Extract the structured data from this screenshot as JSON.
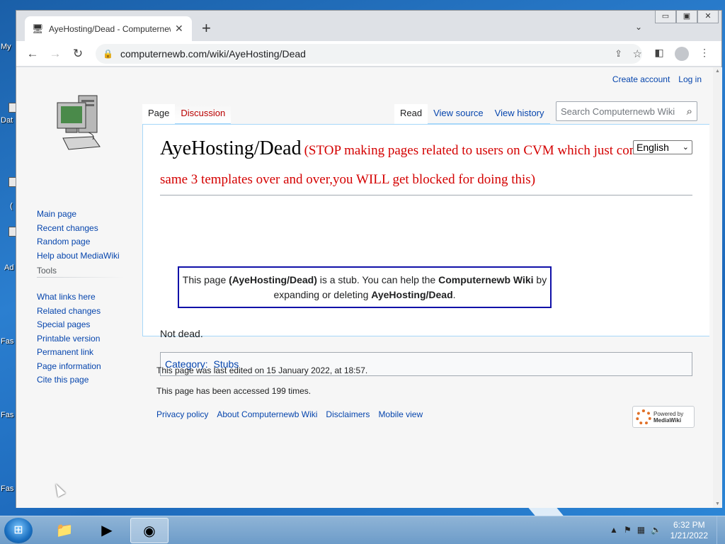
{
  "desktop": {
    "labels": [
      "My",
      "Dat",
      "(",
      "Ad",
      "Fas",
      "Fas",
      "Fas"
    ]
  },
  "browser": {
    "tab": {
      "title": "AyeHosting/Dead - Computernewb Wiki",
      "close": "✕"
    },
    "new_tab": "+",
    "url": "computernewb.com/wiki/AyeHosting/Dead",
    "window_buttons": [
      "▭",
      "▣",
      "✕"
    ]
  },
  "wiki": {
    "personal": {
      "create_account": "Create account",
      "log_in": "Log in"
    },
    "navigation": [
      "Main page",
      "Recent changes",
      "Random page",
      "Help about MediaWiki"
    ],
    "tools_title": "Tools",
    "tools": [
      "What links here",
      "Related changes",
      "Special pages",
      "Printable version",
      "Permanent link",
      "Page information",
      "Cite this page"
    ],
    "tabs_left": {
      "page": "Page",
      "discussion": "Discussion"
    },
    "tabs_right": {
      "read": "Read",
      "view_source": "View source",
      "view_history": "View history"
    },
    "search_placeholder": "Search Computernewb Wiki",
    "language": "English",
    "title": "AyeHosting/Dead",
    "warning": "(STOP making pages related to users on CVM which just contain the same 3 templates over and over,you WILL get blocked for doing this)",
    "stub": {
      "p1": "This page ",
      "page_name": "(AyeHosting/Dead)",
      "p2": " is a stub. You can help the ",
      "wiki_name": "Computernewb Wiki",
      "p3": " by expanding or deleting ",
      "page_name2": "AyeHosting/Dead",
      "p4": "."
    },
    "body_text": "Not dead.",
    "category_label": "Category:",
    "category": "Stubs",
    "footer": {
      "last_edited": "This page was last edited on 15 January 2022, at 18:57.",
      "accessed": "This page has been accessed 199 times.",
      "links": [
        "Privacy policy",
        "About Computernewb Wiki",
        "Disclaimers",
        "Mobile view"
      ],
      "powered_by": "Powered by",
      "mediawiki": "MediaWiki"
    }
  },
  "taskbar": {
    "time": "6:32 PM",
    "date": "1/21/2022"
  }
}
